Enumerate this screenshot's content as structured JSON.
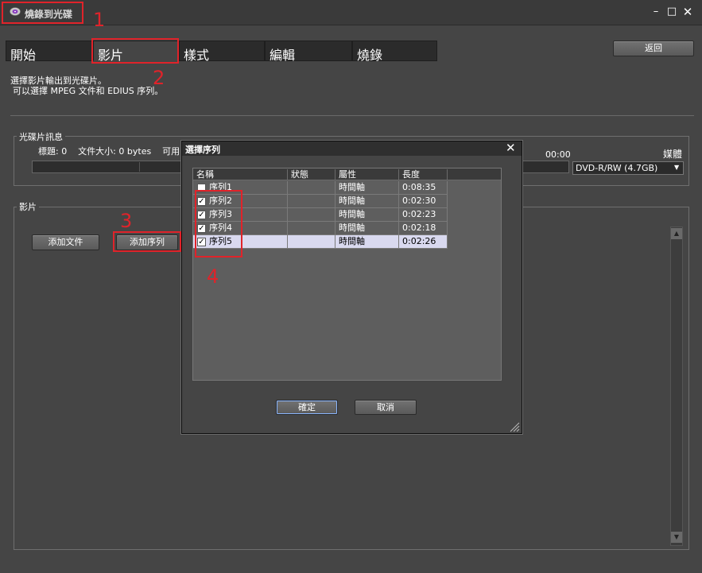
{
  "window": {
    "title": "燒錄到光碟",
    "minimize_label": "–",
    "maximize_label": "□",
    "close_label": "✕"
  },
  "tabs": [
    {
      "label": "開始"
    },
    {
      "label": "影片"
    },
    {
      "label": "樣式"
    },
    {
      "label": "編輯"
    },
    {
      "label": "燒錄"
    }
  ],
  "back_label": "返回",
  "instructions": {
    "line1": "選擇影片輸出到光碟片。",
    "line2": "可以選擇 MPEG 文件和 EDIUS 序列。"
  },
  "disc_info": {
    "label": "光碟片訊息",
    "stats": "標題: 0    文件大小: 0 bytes    可用:",
    "time": "00:00",
    "media_label": "媒體",
    "media_value": "DVD-R/RW (4.7GB)"
  },
  "video_section": {
    "label": "影片",
    "add_file_label": "添加文件",
    "add_sequence_label": "添加序列"
  },
  "dialog": {
    "title": "選擇序列",
    "close_label": "✕",
    "columns": [
      "名稱",
      "狀態",
      "屬性",
      "長度"
    ],
    "rows": [
      {
        "name": "序列1",
        "status": "",
        "property": "時間軸",
        "length": "0:08:35",
        "checked": false
      },
      {
        "name": "序列2",
        "status": "",
        "property": "時間軸",
        "length": "0:02:30",
        "checked": true
      },
      {
        "name": "序列3",
        "status": "",
        "property": "時間軸",
        "length": "0:02:23",
        "checked": true
      },
      {
        "name": "序列4",
        "status": "",
        "property": "時間軸",
        "length": "0:02:18",
        "checked": true
      },
      {
        "name": "序列5",
        "status": "",
        "property": "時間軸",
        "length": "0:02:26",
        "checked": true
      }
    ],
    "ok_label": "確定",
    "cancel_label": "取消"
  },
  "annotations": [
    "1",
    "2",
    "3",
    "4"
  ],
  "colors": {
    "annotation": "#e0232a",
    "background": "#454545",
    "selected_row": "#d9d9ef"
  }
}
